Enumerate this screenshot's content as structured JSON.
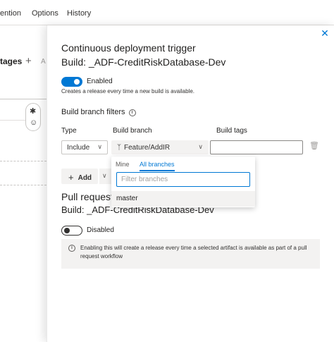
{
  "nav": {
    "items": [
      "ention",
      "Options",
      "History"
    ]
  },
  "background": {
    "stages_label": "tages",
    "add_glyph": "+",
    "add_partial": "A"
  },
  "panel": {
    "title": "Continuous deployment trigger",
    "build_line": "Build: _ADF-CreditRiskDatabase-Dev",
    "enabled_toggle": {
      "state": true,
      "label": "Enabled"
    },
    "enabled_description": "Creates a release every time a new build is available.",
    "filters_heading": "Build branch filters",
    "columns": {
      "type": "Type",
      "branch": "Build branch",
      "tags": "Build tags"
    },
    "filter_row": {
      "type_value": "Include",
      "branch_value": "Feature/AddIR",
      "tags_value": ""
    },
    "add_label": "Add",
    "branch_popup": {
      "tabs": [
        "Mine",
        "All branches"
      ],
      "active_tab": "All branches",
      "filter_placeholder": "Filter branches",
      "options": [
        "master"
      ]
    },
    "pull_request": {
      "heading": "Pull request",
      "build_line": "Build: _ADF-CreditRiskDatabase-Dev",
      "toggle": {
        "state": false,
        "label": "Disabled"
      },
      "info": "Enabling this will create a release every time a selected artifact is available as part of a pull request workflow"
    }
  },
  "colors": {
    "accent": "#0078d4",
    "neutral_bg": "#f3f2f1",
    "text": "#201f1e"
  },
  "icons": [
    "close-icon",
    "info-icon",
    "branch-icon",
    "chevron-down-icon",
    "trash-icon",
    "plus-icon",
    "rocket-icon",
    "person-icon"
  ]
}
